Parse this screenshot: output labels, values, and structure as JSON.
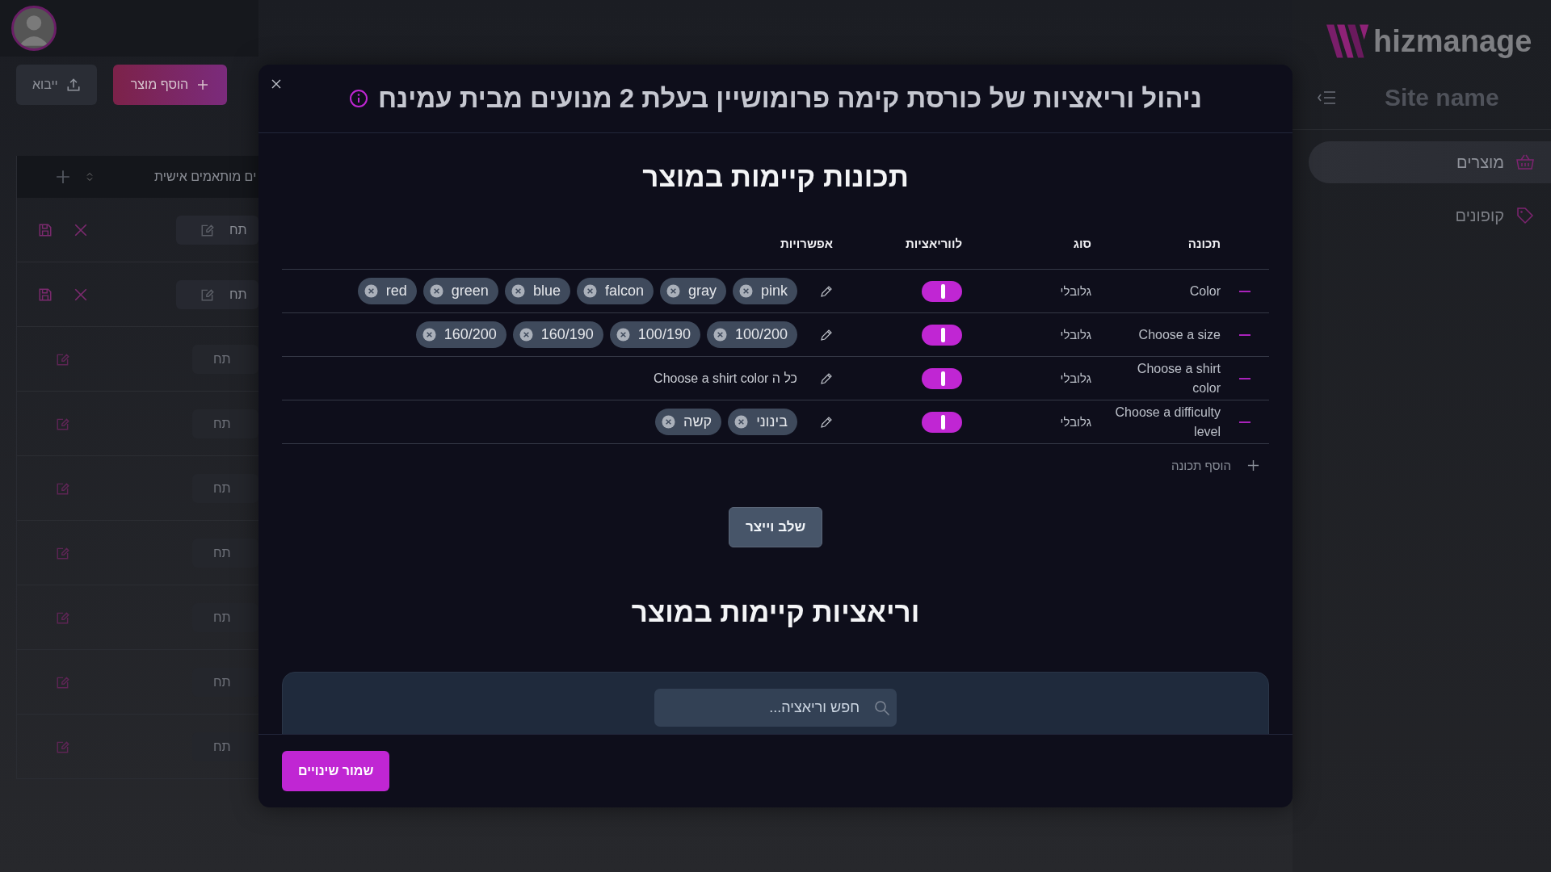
{
  "background": {
    "buttons": [
      {
        "label": "הוסף מוצר",
        "kind": "add"
      },
      {
        "label": "ייבוא",
        "kind": "import"
      }
    ],
    "table_header": "ים מותאמים אישית",
    "rows": [
      {
        "cell": "תח",
        "editing": true
      },
      {
        "cell": "תח",
        "editing": true
      },
      {
        "cell": "תח",
        "editing": false
      },
      {
        "cell": "תח",
        "editing": false
      },
      {
        "cell": "תח",
        "editing": false
      },
      {
        "cell": "תח",
        "editing": false
      },
      {
        "cell": "תח",
        "editing": false
      },
      {
        "cell": "תח",
        "editing": false
      },
      {
        "cell": "תח",
        "editing": false
      }
    ]
  },
  "sidebar": {
    "logo": "hizmanage",
    "site_name": "Site name",
    "items": [
      {
        "label": "מוצרים",
        "selected": true,
        "kind": "basket"
      },
      {
        "label": "קופונים",
        "selected": false,
        "kind": "tag"
      }
    ]
  },
  "modal": {
    "title": "ניהול וריאציות של כורסת קימה פרומושיין בעלת 2 מנועים מבית עמינח",
    "features_heading": "תכונות קיימות במוצר",
    "columns": [
      "תכונה",
      "סוג",
      "לווריאציות",
      "אפשרויות"
    ],
    "features": [
      {
        "name": "Color",
        "type": "גלובלי",
        "for_variations": true,
        "options": [
          "pink",
          "gray",
          "falcon",
          "blue",
          "green",
          "red"
        ]
      },
      {
        "name": "Choose a size",
        "type": "גלובלי",
        "for_variations": true,
        "options": [
          "100/200",
          "100/190",
          "160/190",
          "160/200"
        ]
      },
      {
        "name": "Choose a shirt color",
        "type": "גלובלי",
        "for_variations": true,
        "options_text": "כל ה Choose a shirt color"
      },
      {
        "name": "Choose a difficulty level",
        "type": "גלובלי",
        "for_variations": true,
        "options": [
          "בינוני",
          "קשה"
        ]
      }
    ],
    "add_feature": "הוסף תכונה",
    "merge_button": "שלב וייצר",
    "variations_heading": "וריאציות קיימות במוצר",
    "search": {
      "placeholder": "חפש וריאציה..."
    },
    "save_button": "שמור שינויים"
  }
}
